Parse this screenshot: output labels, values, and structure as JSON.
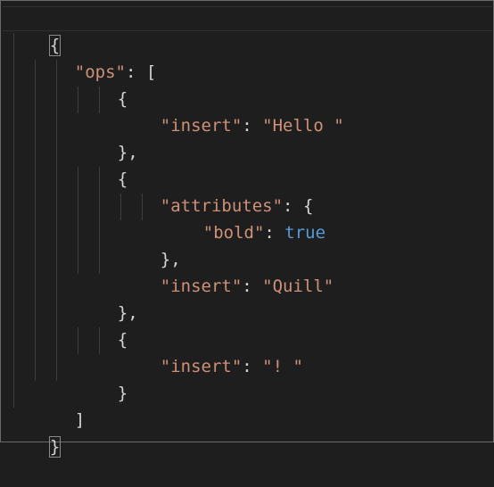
{
  "editor": {
    "lines": [
      {
        "open": "{"
      },
      {
        "key": "\"ops\"",
        "colon": ": ",
        "punc": "["
      },
      {
        "punc": "{"
      },
      {
        "key": "\"insert\"",
        "colon": ": ",
        "str": "\"Hello \""
      },
      {
        "punc": "},"
      },
      {
        "punc": "{"
      },
      {
        "key": "\"attributes\"",
        "colon": ": ",
        "punc": "{"
      },
      {
        "key": "\"bold\"",
        "colon": ": ",
        "bool": "true"
      },
      {
        "punc": "},"
      },
      {
        "key": "\"insert\"",
        "colon": ": ",
        "str": "\"Quill\""
      },
      {
        "punc": "},"
      },
      {
        "punc": "{"
      },
      {
        "key": "\"insert\"",
        "colon": ": ",
        "str": "\"! \""
      },
      {
        "punc": "}"
      },
      {
        "punc": "]"
      },
      {
        "close": "}"
      }
    ]
  }
}
